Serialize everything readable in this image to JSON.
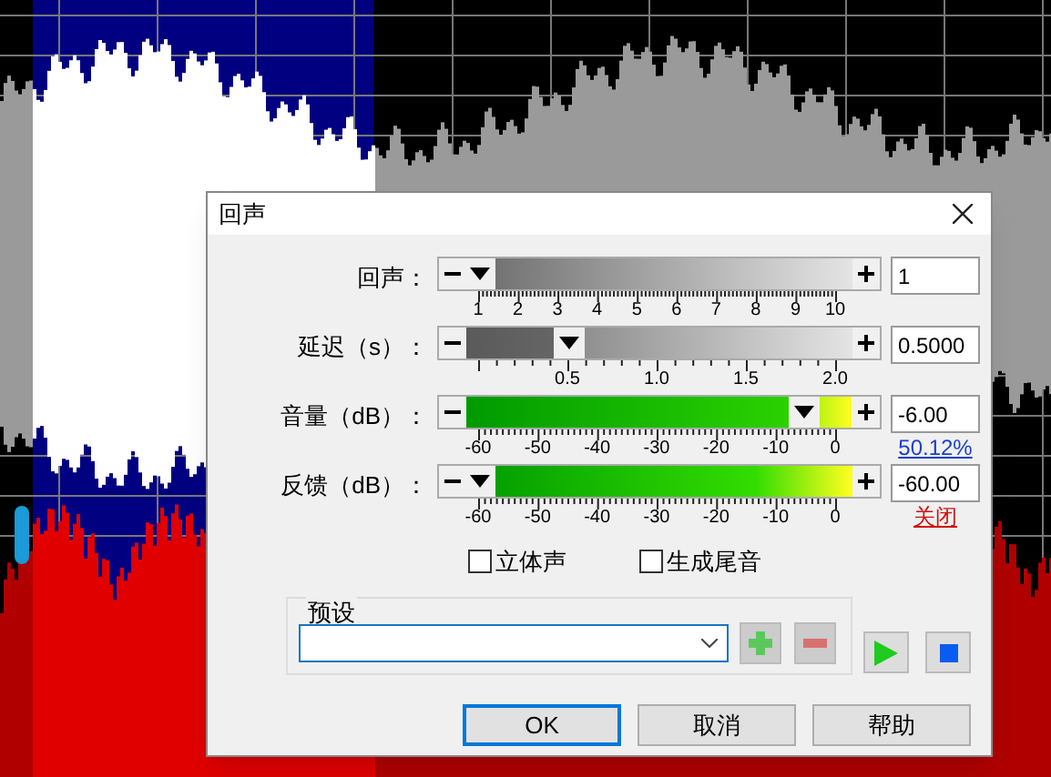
{
  "dialog": {
    "title": "回声"
  },
  "sliders": [
    {
      "label": "回声：",
      "kind": "gray",
      "level": 0,
      "ticks": [
        "1",
        "2",
        "3",
        "4",
        "5",
        "6",
        "7",
        "8",
        "9",
        "10"
      ],
      "value": "1"
    },
    {
      "label": "延迟（s）：",
      "kind": "gray",
      "level": 0.25,
      "ticks": [
        "0.5",
        "1.0",
        "1.5",
        "2.0"
      ],
      "value": "0.5000"
    },
    {
      "label": "音量（dB）：",
      "kind": "green",
      "level": 0.91,
      "ticks": [
        "-60",
        "-50",
        "-40",
        "-30",
        "-20",
        "-10",
        "0"
      ],
      "value": "-6.00",
      "note": {
        "text": "50.12%",
        "kind": "link"
      }
    },
    {
      "label": "反馈（dB）：",
      "kind": "green",
      "level": 0,
      "ticks": [
        "-60",
        "-50",
        "-40",
        "-30",
        "-20",
        "-10",
        "0"
      ],
      "value": "-60.00",
      "note": {
        "text": "关闭",
        "kind": "off"
      }
    }
  ],
  "checkboxes": [
    {
      "label": "立体声",
      "checked": false
    },
    {
      "label": "生成尾音",
      "checked": false
    }
  ],
  "preset": {
    "label": "预设"
  },
  "buttons": [
    {
      "label": "OK",
      "selected": true
    },
    {
      "label": "取消",
      "selected": false
    },
    {
      "label": "帮助",
      "selected": false
    }
  ]
}
